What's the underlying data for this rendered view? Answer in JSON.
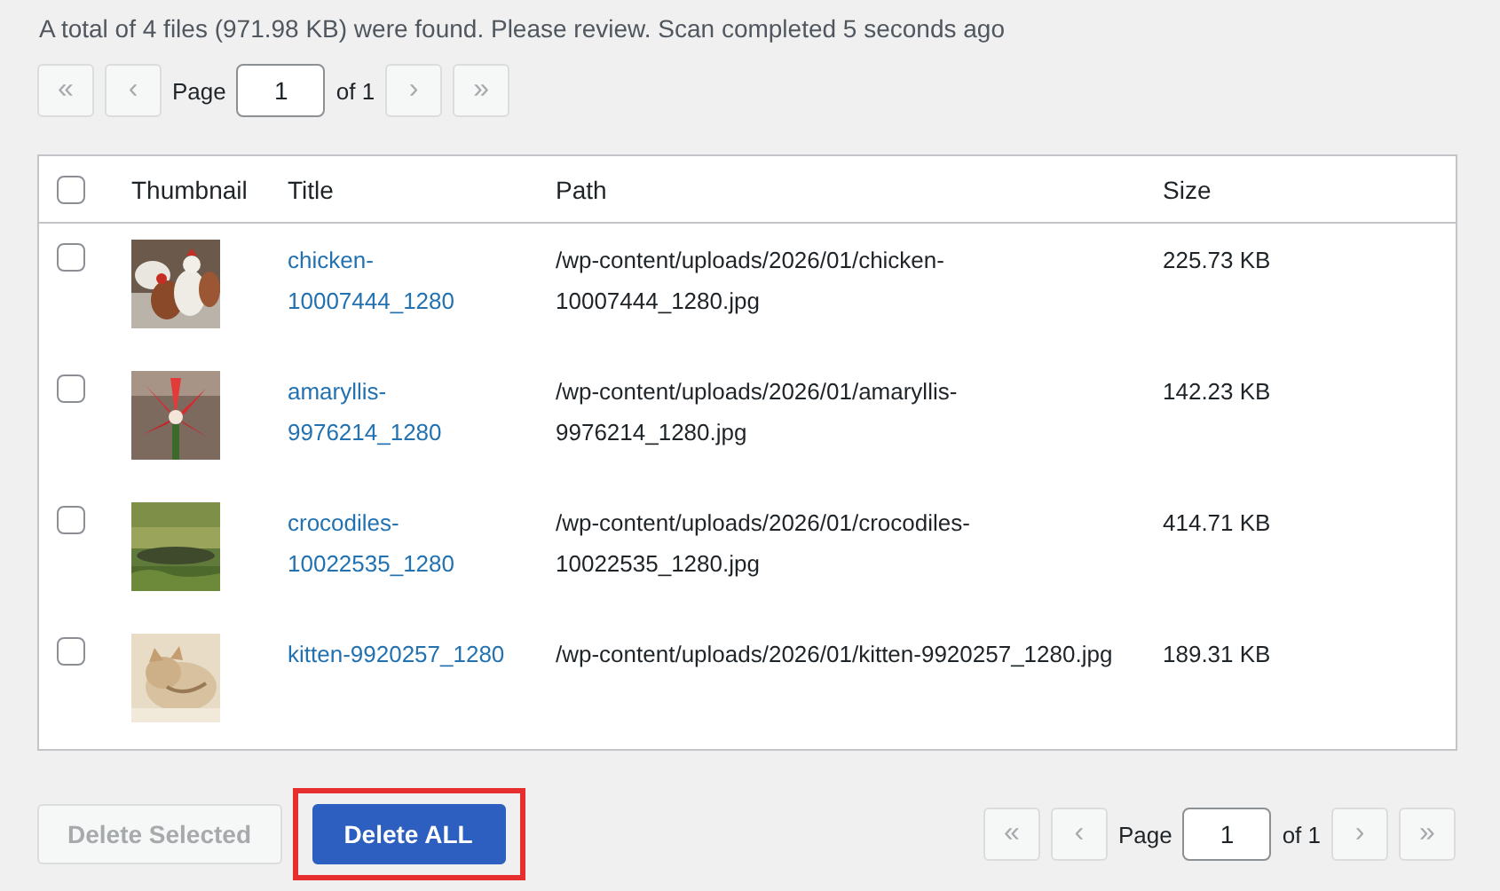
{
  "summary": {
    "text": "A total of 4 files (971.98 KB) were found. Please review.",
    "status": "Scan completed 5 seconds ago"
  },
  "top_pager": {
    "buttons_before": [
      {
        "symbol": "«",
        "disabled": true
      },
      {
        "symbol": "‹",
        "disabled": true
      }
    ],
    "label": "Page",
    "value": "1",
    "of": "of 1",
    "buttons_after": [
      {
        "symbol": "›",
        "disabled": true
      },
      {
        "symbol": "»",
        "disabled": true
      }
    ]
  },
  "table": {
    "select_all": {
      "checked": false
    },
    "columns": [
      "Thumbnail",
      "Title",
      "Path",
      "Size"
    ],
    "rows": [
      {
        "checked": false,
        "title": "chicken-10007444_1280",
        "path": "/wp-content/uploads/2026/01/chicken-10007444_1280.jpg",
        "size": "225.73 KB"
      },
      {
        "checked": false,
        "title": "amaryllis-9976214_1280",
        "path": "/wp-content/uploads/2026/01/amaryllis-9976214_1280.jpg",
        "size": "142.23 KB"
      },
      {
        "checked": false,
        "title": "crocodiles-10022535_1280",
        "path": "/wp-content/uploads/2026/01/crocodiles-10022535_1280.jpg",
        "size": "414.71 KB"
      },
      {
        "checked": false,
        "title": "kitten-9920257_1280",
        "path": "/wp-content/uploads/2026/01/kitten-9920257_1280.jpg",
        "size": "189.31 KB"
      }
    ]
  },
  "actions": [
    {
      "label": "Delete Selected",
      "kind": "secondary",
      "disabled": true,
      "highlighted": false
    },
    {
      "label": "Delete ALL",
      "kind": "primary",
      "disabled": false,
      "highlighted": true
    }
  ],
  "bottom_pager": {
    "buttons_before": [
      {
        "symbol": "«",
        "disabled": true
      },
      {
        "symbol": "‹",
        "disabled": true
      }
    ],
    "label": "Page",
    "value": "1",
    "of": "of 1",
    "buttons_after": [
      {
        "symbol": "›",
        "disabled": true
      },
      {
        "symbol": "»",
        "disabled": true
      }
    ]
  }
}
